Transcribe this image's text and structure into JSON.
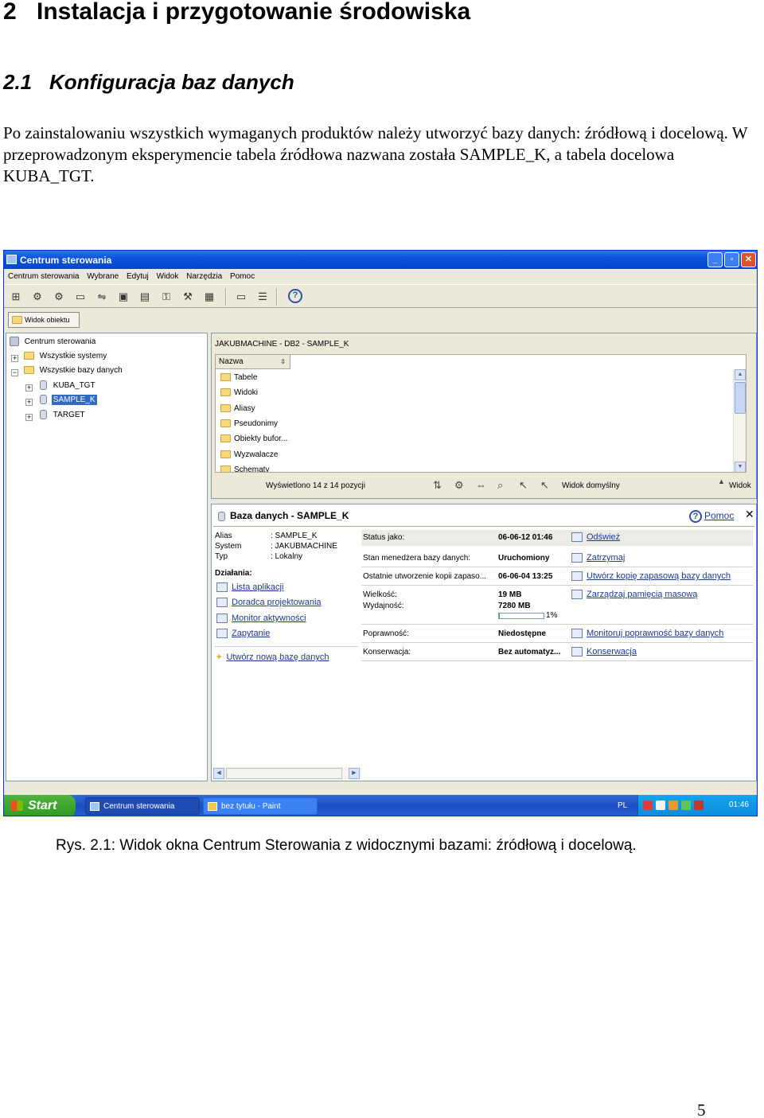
{
  "doc": {
    "h1_num": "2",
    "h1_text": "Instalacja i przygotowanie środowiska",
    "h2_num": "2.1",
    "h2_text": "Konfiguracja baz danych",
    "paragraph": "Po zainstalowaniu wszystkich wymaganych produktów należy utworzyć bazy danych: źródłową i docelową. W przeprowadzonym eksperymencie tabela źródłowa nazwana została SAMPLE_K, a tabela docelowa KUBA_TGT.",
    "caption": "Rys. 2.1: Widok okna Centrum Sterowania z widocznymi bazami: źródłową i docelową.",
    "page_number": "5"
  },
  "window": {
    "title": "Centrum sterowania",
    "menu": [
      "Centrum sterowania",
      "Wybrane",
      "Edytuj",
      "Widok",
      "Narzędzia",
      "Pomoc"
    ],
    "view_tab": "Widok obiektu",
    "tree": {
      "root": "Centrum sterowania",
      "systems": "Wszystkie systemy",
      "databases": "Wszystkie bazy danych",
      "db1": "KUBA_TGT",
      "db2": "SAMPLE_K",
      "db3": "TARGET"
    },
    "object_pane": {
      "path": "JAKUBMACHINE - DB2 - SAMPLE_K",
      "column": "Nazwa",
      "items": [
        "Tabele",
        "Widoki",
        "Aliasy",
        "Pseudonimy",
        "Obiekty bufor...",
        "Wyzwalacze",
        "Schematy"
      ],
      "count_text": "Wyświetlono 14 z 14 pozycji",
      "view_default": "Widok domyślny",
      "view": "Widok"
    },
    "details": {
      "title": "Baza danych - SAMPLE_K",
      "help": "Pomoc",
      "alias_label": "Alias",
      "alias_value": ": SAMPLE_K",
      "system_label": "System",
      "system_value": ": JAKUBMACHINE",
      "type_label": "Typ",
      "type_value": ": Lokalny",
      "actions_label": "Działania:",
      "actions": [
        "Lista aplikacji",
        "Doradca projektowania",
        "Monitor aktywności",
        "Zapytanie"
      ],
      "create_db": "Utwórz nową bazę danych",
      "status_rows": [
        {
          "label": "Status jako:",
          "value": "06-06-12 01:46",
          "action": "Odśwież"
        },
        {
          "label": "Stan menedżera bazy danych:",
          "value": "Uruchomiony",
          "action": "Zatrzymaj"
        },
        {
          "label": "Ostatnie utworzenie kopii zapaso...",
          "value": "06-06-04 13:25",
          "action": "Utwórz kopię zapasową bazy danych"
        },
        {
          "label": "Wielkość:",
          "value": "19 MB",
          "action": "Zarządzaj pamięcią masową"
        },
        {
          "label": "Wydajność:",
          "value": "7280 MB",
          "action": ""
        },
        {
          "label": "Poprawność:",
          "value": "Niedostępne",
          "action": "Monitoruj poprawność bazy danych"
        },
        {
          "label": "Konserwacja:",
          "value": "Bez automatyz...",
          "action": "Konserwacja"
        }
      ],
      "usage_percent_label": "1%",
      "usage_fraction": 0.01
    }
  },
  "taskbar": {
    "start": "Start",
    "tasks": [
      "Centrum sterowania",
      "bez tytułu - Paint"
    ],
    "lang": "PL",
    "clock": "01:46"
  }
}
